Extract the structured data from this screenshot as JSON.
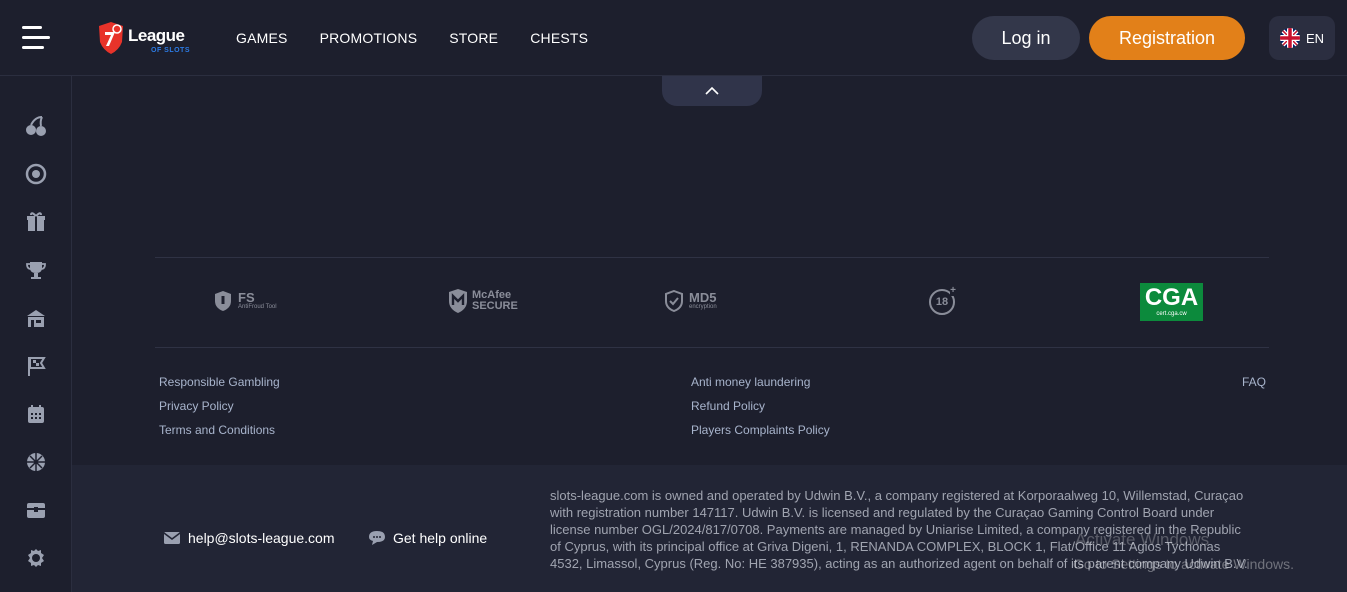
{
  "header": {
    "logo_text": "League",
    "logo_sub": "OF SLOTS",
    "nav": [
      "GAMES",
      "PROMOTIONS",
      "STORE",
      "CHESTS"
    ],
    "login_label": "Log in",
    "registration_label": "Registration",
    "language": "EN"
  },
  "sidebar": {
    "items": [
      "cherry-icon",
      "roulette-icon",
      "gift-icon",
      "trophy-icon",
      "shop-icon",
      "tournament-flag-icon",
      "calendar-icon",
      "sports-ball-icon",
      "chest-icon",
      "award-icon"
    ]
  },
  "badges": {
    "fs_title": "FS",
    "fs_sub": "AntiFroud Tool",
    "mcafee_title": "McAfee",
    "mcafee_sub": "SECURE",
    "md5_title": "MD5",
    "md5_sub": "encryption",
    "age": "18",
    "cga_title": "CGA",
    "cga_sub": "cert.cga.cw"
  },
  "footer_links": {
    "col1": [
      "Responsible Gambling",
      "Privacy Policy",
      "Terms and Conditions"
    ],
    "col2": [
      "Anti money laundering",
      "Refund Policy",
      "Players Complaints Policy"
    ],
    "col3": [
      "FAQ"
    ]
  },
  "contact": {
    "email": "help@slots-league.com",
    "help": "Get help online"
  },
  "legal": "slots-league.com is owned and operated by Udwin B.V., a company registered at Korporaalweg 10, Willemstad, Curaçao with registration number 147117. Udwin B.V. is licensed and regulated by the Curaçao Gaming Control Board under license number OGL/2024/817/0708. Payments are managed by Uniarise Limited, a company registered in the Republic of Cyprus, with its principal office at Griva Digeni, 1, RENANDA COMPLEX, BLOCK 1, Flat/Office 11 Agios Tychonas 4532, Limassol, Cyprus (Reg. No: HE 387935), acting as an authorized agent on behalf of its parent company Udwin B.V.",
  "watermark": {
    "line1": "Activate Windows",
    "line2": "Go to Settings to activate Windows."
  },
  "colors": {
    "background": "#1d1f2d",
    "accent": "#e28019",
    "login_bg": "#33374a",
    "cga_green": "#0c8a3c"
  }
}
